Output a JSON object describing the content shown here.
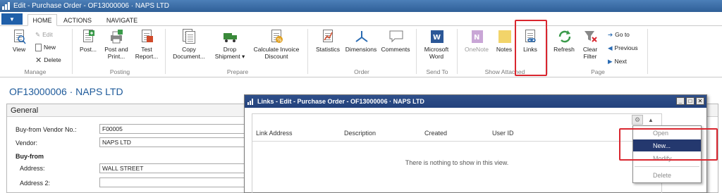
{
  "window": {
    "title": "Edit - Purchase Order - OF13000006 · NAPS LTD"
  },
  "tabs": [
    {
      "label": "HOME",
      "active": true
    },
    {
      "label": "ACTIONS",
      "active": false
    },
    {
      "label": "NAVIGATE",
      "active": false
    }
  ],
  "ribbon": {
    "manage": {
      "group": "Manage",
      "view": "View",
      "edit": "Edit",
      "new": "New",
      "delete": "Delete"
    },
    "posting": {
      "group": "Posting",
      "post": "Post...",
      "post_and_print_1": "Post and",
      "post_and_print_2": "Print...",
      "test_report_1": "Test",
      "test_report_2": "Report..."
    },
    "prepare": {
      "group": "Prepare",
      "copy_document_1": "Copy",
      "copy_document_2": "Document...",
      "drop_shipment_1": "Drop",
      "drop_shipment_2": "Shipment",
      "calc_invoice_discount_1": "Calculate Invoice",
      "calc_invoice_discount_2": "Discount"
    },
    "order": {
      "group": "Order",
      "statistics": "Statistics",
      "dimensions": "Dimensions",
      "comments": "Comments"
    },
    "send_to": {
      "group": "Send To",
      "word_1": "Microsoft",
      "word_2": "Word"
    },
    "show_attached": {
      "group": "Show Attached",
      "onenote": "OneNote",
      "notes": "Notes",
      "links": "Links"
    },
    "page": {
      "group": "Page",
      "refresh": "Refresh",
      "clear_filter_1": "Clear",
      "clear_filter_2": "Filter",
      "go_to": "Go to",
      "previous": "Previous",
      "next": "Next"
    }
  },
  "page": {
    "title": "OF13000006 · NAPS LTD",
    "general": {
      "header": "General",
      "buy_from_vendor_no_label": "Buy-from Vendor No.:",
      "buy_from_vendor_no_value": "F00005",
      "vendor_label": "Vendor:",
      "vendor_value": "NAPS LTD",
      "buy_from_heading": "Buy-from",
      "address_label": "Address:",
      "address_value": "WALL STREET",
      "address2_label": "Address 2:",
      "address2_value": ""
    }
  },
  "links_dialog": {
    "title": "Links - Edit - Purchase Order - OF13000006 · NAPS LTD",
    "columns": [
      "Link Address",
      "Description",
      "Created",
      "User ID"
    ],
    "empty_message": "There is nothing to show in this view."
  },
  "context_menu": {
    "items": [
      {
        "label": "Open",
        "state": "disabled"
      },
      {
        "label": "New...",
        "state": "highlighted"
      },
      {
        "label": "Modify",
        "state": "disabled"
      },
      {
        "label": "Delete",
        "state": "disabled"
      }
    ]
  },
  "colors": {
    "title_bar": "#2f5f97",
    "dialog_title": "#23427c",
    "menu_highlight": "#24386e",
    "annotation_red": "#d9262f",
    "heading_blue": "#1e5a9a"
  }
}
